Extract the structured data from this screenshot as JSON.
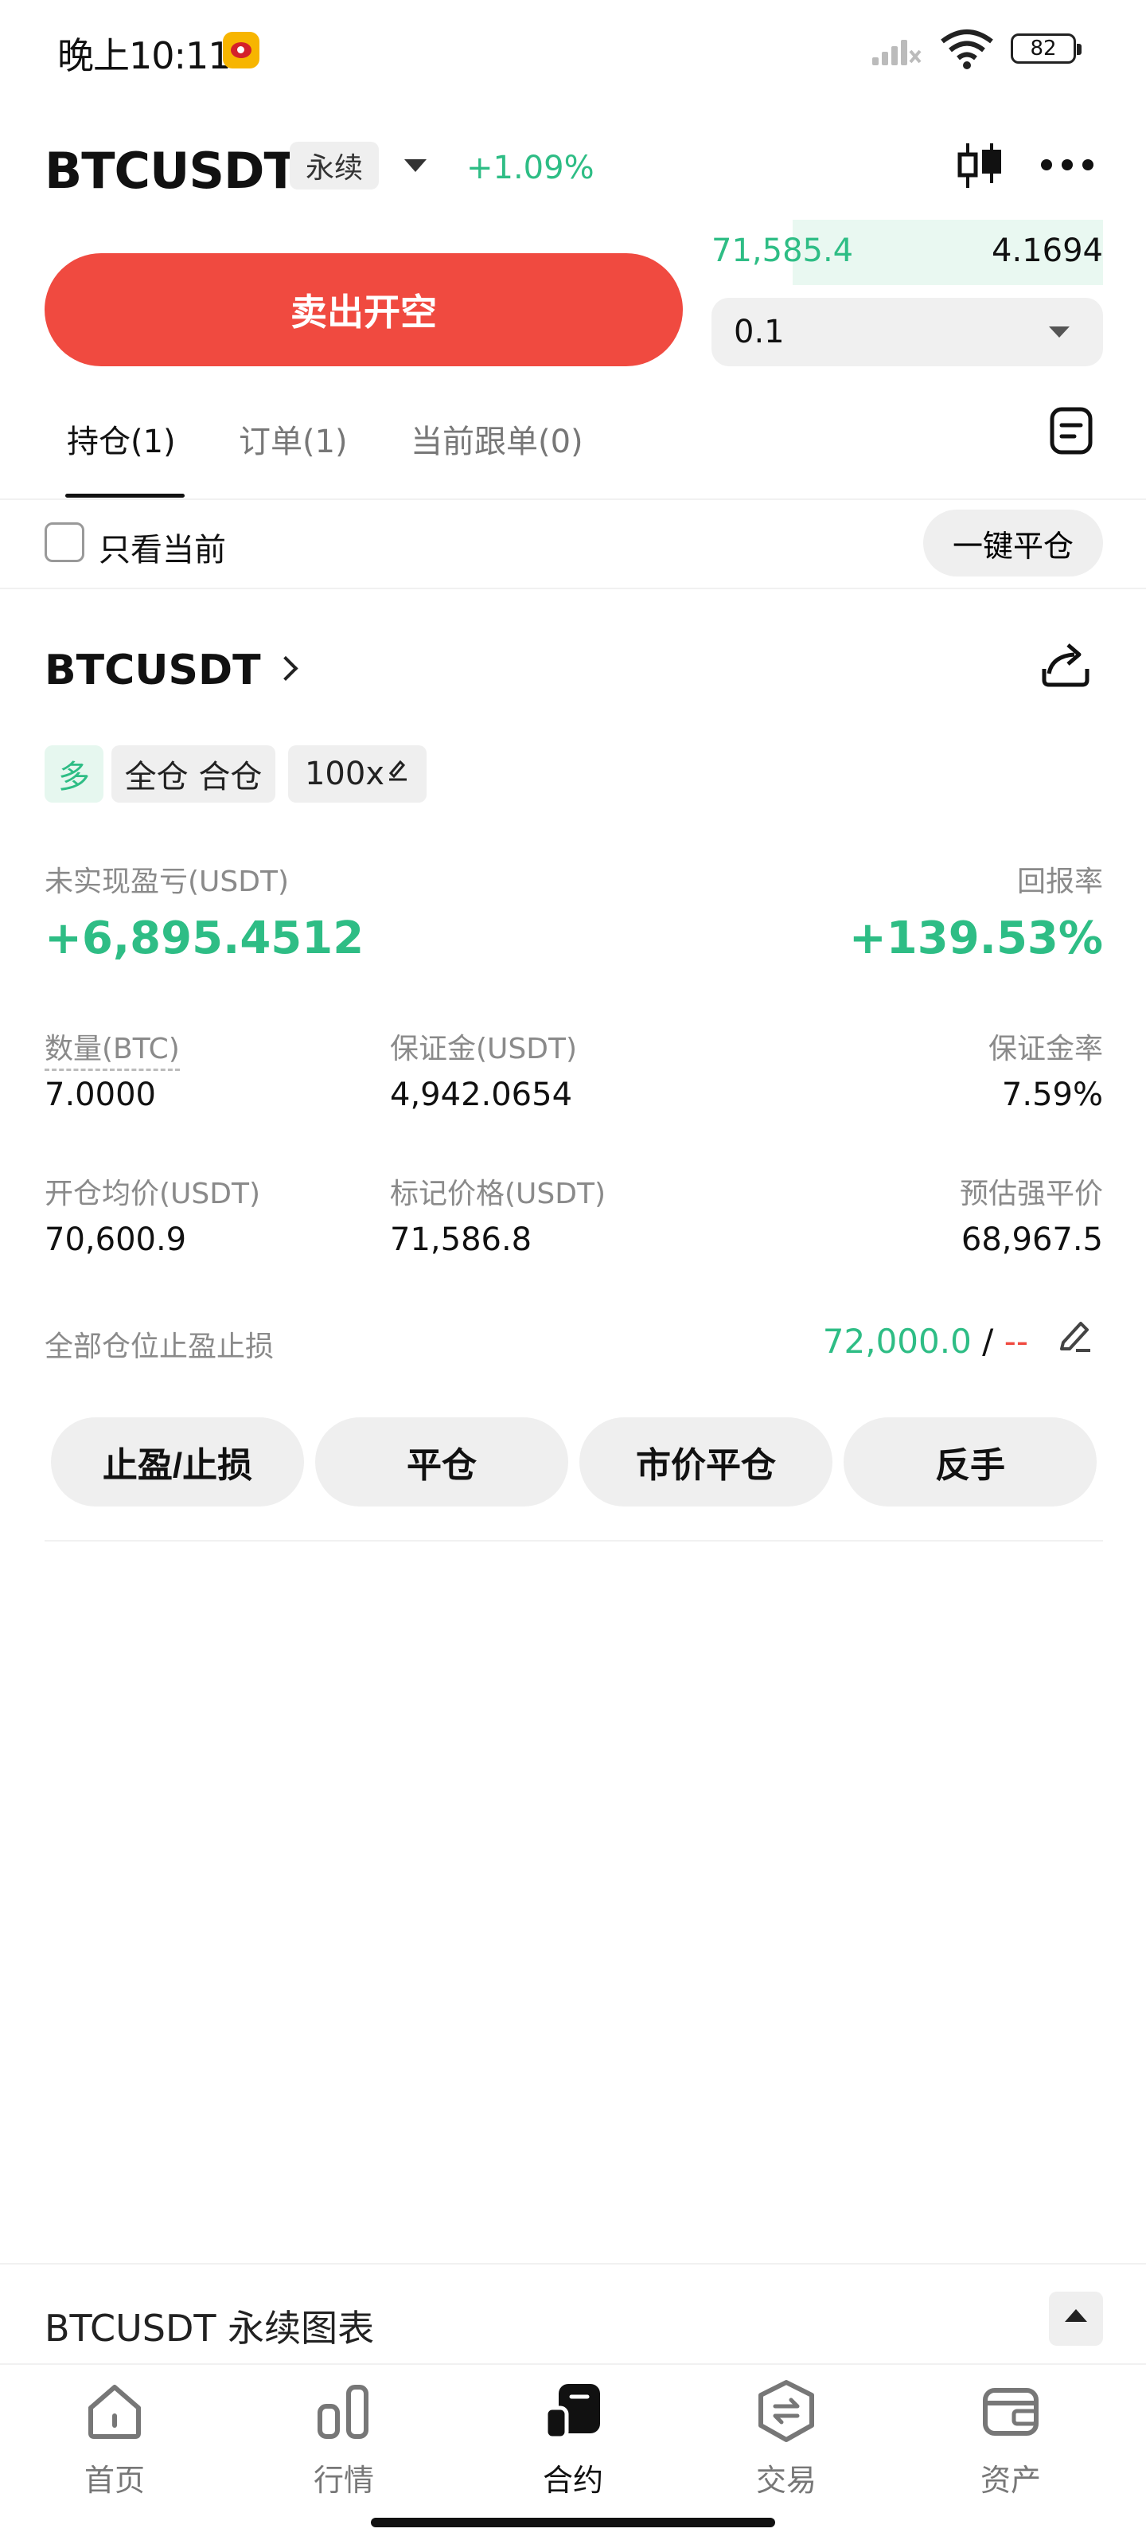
{
  "status_bar": {
    "time": "晚上10:11",
    "battery": "82"
  },
  "header": {
    "symbol": "BTCUSDT",
    "contract_type": "永续",
    "change_pct": "+1.09%"
  },
  "order_panel": {
    "sell_label": "卖出开空",
    "book_price": "71,585.4",
    "book_qty": "4.1694",
    "qty_value": "0.1"
  },
  "tabs": [
    {
      "label": "持仓(1)"
    },
    {
      "label": "订单(1)"
    },
    {
      "label": "当前跟单(0)"
    }
  ],
  "filter": {
    "only_current_label": "只看当前",
    "close_all_label": "一键平仓"
  },
  "position": {
    "symbol": "BTCUSDT",
    "side": "多",
    "margin_mode": "全仓 合仓",
    "leverage": "100x",
    "unrealized_pnl_label": "未实现盈亏(USDT)",
    "unrealized_pnl": "+6,895.4512",
    "roe_label": "回报率",
    "roe": "+139.53%",
    "qty_label": "数量(BTC)",
    "qty": "7.0000",
    "margin_label": "保证金(USDT)",
    "margin": "4,942.0654",
    "margin_ratio_label": "保证金率",
    "margin_ratio": "7.59%",
    "entry_label": "开仓均价(USDT)",
    "entry": "70,600.9",
    "mark_label": "标记价格(USDT)",
    "mark": "71,586.8",
    "liq_label": "预估强平价",
    "liq": "68,967.5",
    "tpsl_label": "全部仓位止盈止损",
    "tp_value": "72,000.0",
    "tpsl_separator": "/",
    "sl_value": "--",
    "actions": [
      "止盈/止损",
      "平仓",
      "市价平仓",
      "反手"
    ]
  },
  "chart_bar": {
    "title": "BTCUSDT 永续图表"
  },
  "bottom_nav": [
    {
      "label": "首页",
      "icon": "home-icon"
    },
    {
      "label": "行情",
      "icon": "market-icon"
    },
    {
      "label": "合约",
      "icon": "futures-icon"
    },
    {
      "label": "交易",
      "icon": "trade-icon"
    },
    {
      "label": "资产",
      "icon": "wallet-icon"
    }
  ],
  "colors": {
    "green": "#2ebd85",
    "red": "#f04a40",
    "chip_bg": "#efefef"
  }
}
